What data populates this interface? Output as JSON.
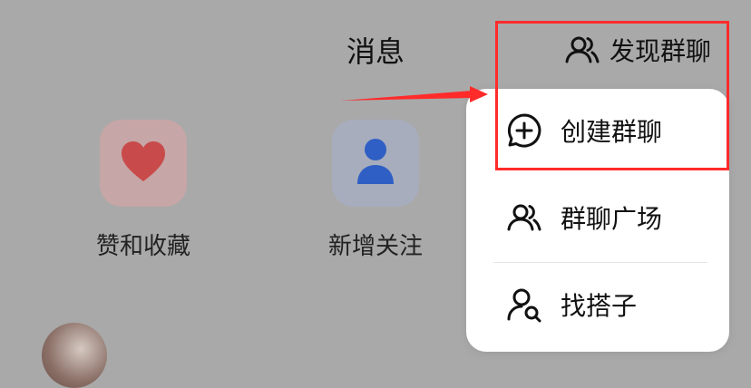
{
  "header": {
    "title": "消息",
    "discover_group_label": "发现群聊"
  },
  "shortcuts": [
    {
      "label": "赞和收藏",
      "icon": "heart-icon",
      "color": "#c94a4a"
    },
    {
      "label": "新增关注",
      "icon": "person-icon",
      "color": "#2f5fc4"
    }
  ],
  "menu": {
    "items": [
      {
        "label": "创建群聊",
        "icon": "chat-plus-icon"
      },
      {
        "label": "群聊广场",
        "icon": "group-icon"
      },
      {
        "label": "找搭子",
        "icon": "person-search-icon"
      }
    ]
  },
  "annotation": {
    "highlight_color": "#ff2b2b"
  }
}
